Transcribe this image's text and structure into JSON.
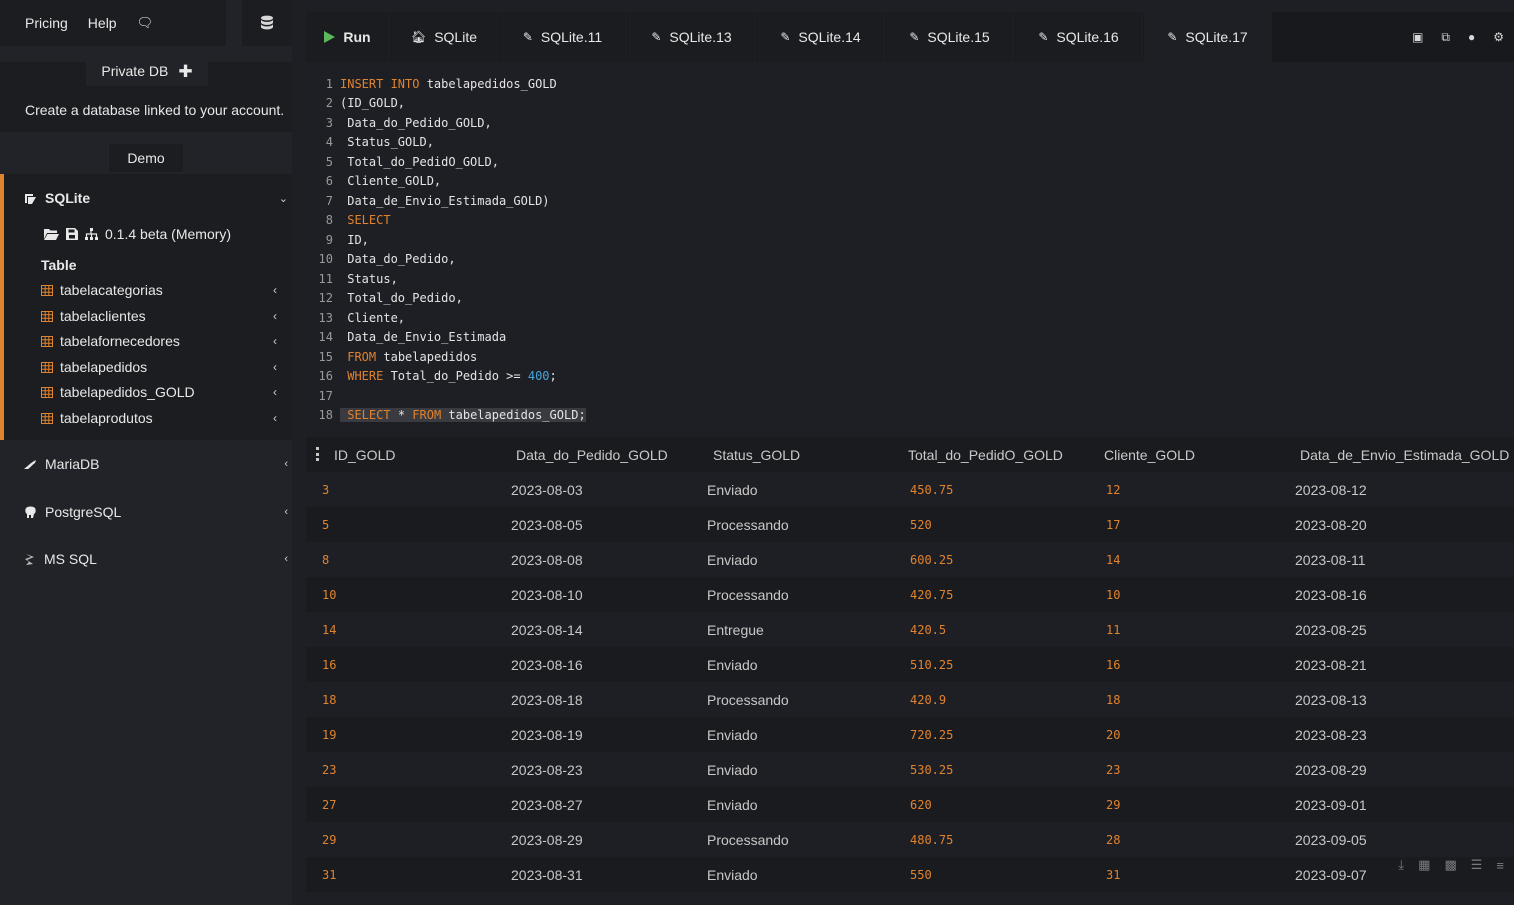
{
  "topbar": {
    "pricing": "Pricing",
    "help": "Help",
    "chat_icon": "🗨"
  },
  "private": {
    "label": "Private DB",
    "plus": "✚",
    "description": "Create a database linked to your account."
  },
  "demo": {
    "label": "Demo"
  },
  "sqlite": {
    "label": "SQLite",
    "version": "0.1.4 beta (Memory)",
    "table_header": "Table",
    "tables": [
      "tabelacategorias",
      "tabelaclientes",
      "tabelafornecedores",
      "tabelapedidos",
      "tabelapedidos_GOLD",
      "tabelaprodutos"
    ]
  },
  "engines": {
    "mariadb": "MariaDB",
    "postgresql": "PostgreSQL",
    "mssql": "MS SQL"
  },
  "tabs": {
    "run": "Run",
    "t0": "SQLite",
    "t1": "SQLite.11",
    "t2": "SQLite.13",
    "t3": "SQLite.14",
    "t4": "SQLite.15",
    "t5": "SQLite.16",
    "t6": "SQLite.17"
  },
  "editor": {
    "line_numbers": [
      "1",
      "2",
      "3",
      "4",
      "5",
      "6",
      "7",
      "8",
      "9",
      "10",
      "11",
      "12",
      "13",
      "14",
      "15",
      "16",
      "17",
      "18"
    ],
    "l1_kw": "INSERT INTO",
    "l1_rest": " tabelapedidos_GOLD",
    "l2": "(ID_GOLD,",
    "l3": " Data_do_Pedido_GOLD,",
    "l4": " Status_GOLD,",
    "l5": " Total_do_PedidO_GOLD,",
    "l6": " Cliente_GOLD,",
    "l7": " Data_de_Envio_Estimada_GOLD)",
    "l8_kw": "SELECT",
    "l9": " ID,",
    "l10": " Data_do_Pedido,",
    "l11": " Status,",
    "l12": " Total_do_Pedido,",
    "l13": " Cliente,",
    "l14": " Data_de_Envio_Estimada",
    "l15_kw": "FROM",
    "l15_rest": " tabelapedidos",
    "l16_kw": "WHERE",
    "l16_mid": " Total_do_Pedido >= ",
    "l16_num": "400",
    "l16_end": ";",
    "l17": "",
    "l18_kw1": "SELECT",
    "l18_mid": " * ",
    "l18_kw2": "FROM",
    "l18_rest": " tabelapedidos_GOLD;"
  },
  "results": {
    "columns": [
      "ID_GOLD",
      "Data_do_Pedido_GOLD",
      "Status_GOLD",
      "Total_do_PedidO_GOLD",
      "Cliente_GOLD",
      "Data_de_Envio_Estimada_GOLD"
    ],
    "rows": [
      [
        "3",
        "2023-08-03",
        "Enviado",
        "450.75",
        "12",
        "2023-08-12"
      ],
      [
        "5",
        "2023-08-05",
        "Processando",
        "520",
        "17",
        "2023-08-20"
      ],
      [
        "8",
        "2023-08-08",
        "Enviado",
        "600.25",
        "14",
        "2023-08-11"
      ],
      [
        "10",
        "2023-08-10",
        "Processando",
        "420.75",
        "10",
        "2023-08-16"
      ],
      [
        "14",
        "2023-08-14",
        "Entregue",
        "420.5",
        "11",
        "2023-08-25"
      ],
      [
        "16",
        "2023-08-16",
        "Enviado",
        "510.25",
        "16",
        "2023-08-21"
      ],
      [
        "18",
        "2023-08-18",
        "Processando",
        "420.9",
        "18",
        "2023-08-13"
      ],
      [
        "19",
        "2023-08-19",
        "Enviado",
        "720.25",
        "20",
        "2023-08-23"
      ],
      [
        "23",
        "2023-08-23",
        "Enviado",
        "530.25",
        "23",
        "2023-08-29"
      ],
      [
        "27",
        "2023-08-27",
        "Enviado",
        "620",
        "29",
        "2023-09-01"
      ],
      [
        "29",
        "2023-08-29",
        "Processando",
        "480.75",
        "28",
        "2023-09-05"
      ],
      [
        "31",
        "2023-08-31",
        "Enviado",
        "550",
        "31",
        "2023-09-07"
      ]
    ]
  },
  "colors": {
    "accent": "#e0832f",
    "number": "#4aa3d8",
    "background": "#1e1f24",
    "sidebar": "#222328"
  }
}
